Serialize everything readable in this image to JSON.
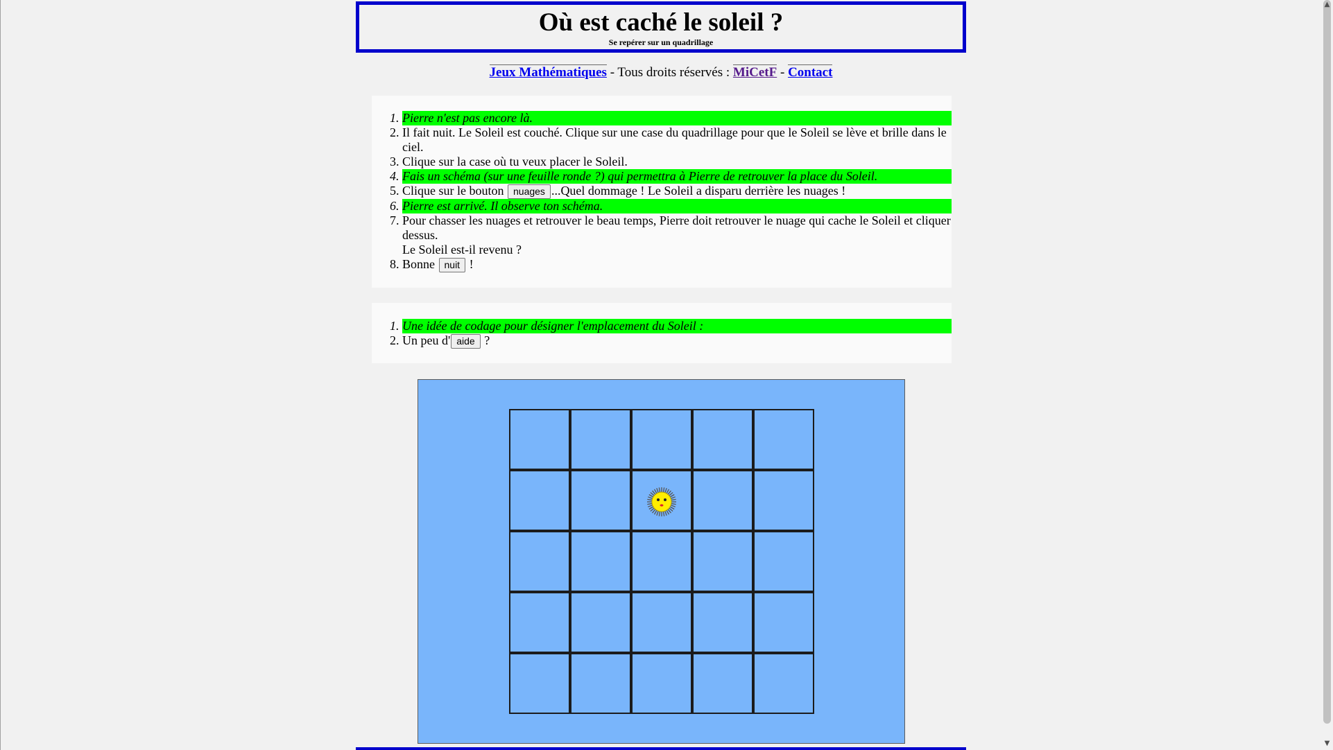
{
  "header": {
    "title": "Où est caché le soleil ?",
    "subtitle": "Se repérer sur un quadrillage"
  },
  "nav": {
    "link_games": "Jeux Mathématiques",
    "sep1": " - Tous droits réservés : ",
    "link_micetf": "MiCetF",
    "sep2": " - ",
    "link_contact": "Contact"
  },
  "instructions": {
    "step1": "Pierre n'est pas encore là.",
    "step2": "Il fait nuit. Le Soleil est couché. Clique sur une case du quadrillage pour que le Soleil se lève et brille dans le ciel.",
    "step3": "Clique sur la case où tu veux placer le Soleil.",
    "step4": "Fais un schéma (sur une feuille ronde ?) qui permettra à Pierre de retrouver la place du Soleil.",
    "step5_before": "Clique sur le bouton ",
    "step5_button": "nuages",
    "step5_after": "...Quel dommage ! Le Soleil a disparu derrière les nuages !",
    "step6": "Pierre est arrivé. Il observe ton schéma.",
    "step7_line1": "Pour chasser les nuages et retrouver le beau temps, Pierre doit retrouver le nuage qui cache le Soleil et cliquer dessus.",
    "step7_line2": "Le Soleil est-il revenu ?",
    "step8_before": "Bonne ",
    "step8_button": "nuit",
    "step8_after": " !"
  },
  "hints": {
    "item1": "Une idée de codage pour désigner l'emplacement du Soleil :",
    "item2_before": "Un peu d'",
    "item2_button": "aide",
    "item2_after": " ?"
  },
  "grid": {
    "rows": 5,
    "cols": 5,
    "sun_row": 2,
    "sun_col": 3
  },
  "colors": {
    "header_border": "#0000cc",
    "highlight": "#00ff00",
    "sky": "#79b5fb",
    "sun": "#ffee00"
  }
}
